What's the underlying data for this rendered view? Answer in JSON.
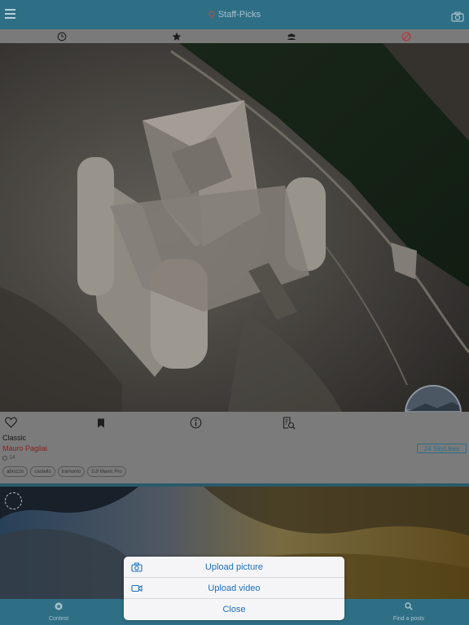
{
  "header": {
    "title": "Staff-Picks",
    "menu_icon": "hamburger-icon",
    "camera_icon": "camera-icon"
  },
  "segments": [
    {
      "icon": "clock-icon",
      "selected": false
    },
    {
      "icon": "star-icon",
      "selected": true
    },
    {
      "icon": "group-icon",
      "selected": false
    },
    {
      "icon": "no-edit-icon",
      "selected": false
    }
  ],
  "post": {
    "category": "Classic",
    "author": "Mauro Pagliai",
    "views": "14",
    "likes": "24 SkyLikes",
    "tags": [
      "abruzzo",
      "castello",
      "tramonto",
      "DJI Mavic Pro"
    ],
    "colors": {
      "author": "#8a1e1e",
      "likes": "#2c6f8a"
    }
  },
  "tabbar": {
    "items": [
      {
        "label": "Contest",
        "icon": "contest-icon"
      },
      {
        "label": "Find a posts",
        "icon": "search-icon"
      }
    ]
  },
  "action_sheet": {
    "upload_picture": "Upload picture",
    "upload_video": "Upload video",
    "close": "Close",
    "accent": "#1a6fc0"
  }
}
